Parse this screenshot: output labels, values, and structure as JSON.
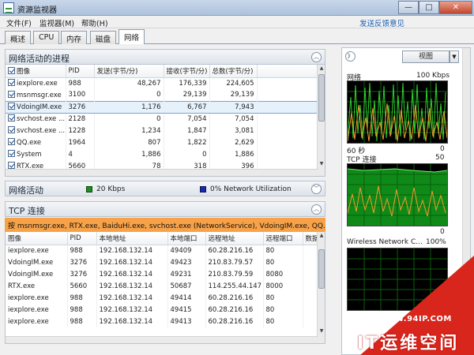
{
  "window": {
    "title": "资源监视器",
    "feedback_link": "发送反馈意见",
    "minimize": "—",
    "maximize": "□",
    "close": "✕"
  },
  "menu": [
    {
      "label": "文件(F)"
    },
    {
      "label": "监视器(M)"
    },
    {
      "label": "帮助(H)"
    }
  ],
  "tabs": [
    {
      "label": "概述"
    },
    {
      "label": "CPU"
    },
    {
      "label": "内存"
    },
    {
      "label": "磁盘"
    },
    {
      "label": "网络"
    }
  ],
  "processes": {
    "title": "网络活动的进程",
    "columns": [
      "图像",
      "PID",
      "发送(字节/分)",
      "接收(字节/分)",
      "总数(字节/分)"
    ],
    "rows": [
      {
        "image": "iexplore.exe",
        "pid": "988",
        "sent": "48,267",
        "recv": "176,339",
        "total": "224,605",
        "checked": true
      },
      {
        "image": "msnmsgr.exe",
        "pid": "3100",
        "sent": "0",
        "recv": "29,139",
        "total": "29,139",
        "checked": true
      },
      {
        "image": "VdoingIM.exe",
        "pid": "3276",
        "sent": "1,176",
        "recv": "6,767",
        "total": "7,943",
        "checked": true,
        "selected": true
      },
      {
        "image": "svchost.exe ...",
        "pid": "2128",
        "sent": "0",
        "recv": "7,054",
        "total": "7,054",
        "checked": true
      },
      {
        "image": "svchost.exe ...",
        "pid": "1228",
        "sent": "1,234",
        "recv": "1,847",
        "total": "3,081",
        "checked": true
      },
      {
        "image": "QQ.exe",
        "pid": "1964",
        "sent": "807",
        "recv": "1,822",
        "total": "2,629",
        "checked": true
      },
      {
        "image": "System",
        "pid": "4",
        "sent": "1,886",
        "recv": "0",
        "total": "1,886",
        "checked": true
      },
      {
        "image": "RTX.exe",
        "pid": "5660",
        "sent": "78",
        "recv": "318",
        "total": "396",
        "checked": true
      }
    ]
  },
  "network_activity": {
    "title": "网络活动",
    "kbps": "20 Kbps",
    "utilization": "0% Network Utilization",
    "color_green": "#1e8c1e",
    "color_blue": "#1b2aa8"
  },
  "tcp": {
    "title": "TCP 连接",
    "filter": "按 msnmsgr.exe, RTX.exe, BaiduHi.exe, svchost.exe (NetworkService), VdoingIM.exe, QQ.e...",
    "columns": [
      "图像",
      "PID",
      "本地地址",
      "本地端口",
      "远程地址",
      "远程端口",
      "数据"
    ],
    "rows": [
      {
        "image": "iexplore.exe",
        "pid": "988",
        "local": "192.168.132.14",
        "lport": "49409",
        "remote": "60.28.216.16",
        "rport": "80"
      },
      {
        "image": "VdoingIM.exe",
        "pid": "3276",
        "local": "192.168.132.14",
        "lport": "49423",
        "remote": "210.83.79.57",
        "rport": "80"
      },
      {
        "image": "VdoingIM.exe",
        "pid": "3276",
        "local": "192.168.132.14",
        "lport": "49231",
        "remote": "210.83.79.59",
        "rport": "8080"
      },
      {
        "image": "RTX.exe",
        "pid": "5660",
        "local": "192.168.132.14",
        "lport": "50687",
        "remote": "114.255.44.147",
        "rport": "8000"
      },
      {
        "image": "iexplore.exe",
        "pid": "988",
        "local": "192.168.132.14",
        "lport": "49414",
        "remote": "60.28.216.16",
        "rport": "80"
      },
      {
        "image": "iexplore.exe",
        "pid": "988",
        "local": "192.168.132.14",
        "lport": "49415",
        "remote": "60.28.216.16",
        "rport": "80"
      },
      {
        "image": "iexplore.exe",
        "pid": "988",
        "local": "192.168.132.14",
        "lport": "49413",
        "remote": "60.28.216.16",
        "rport": "80"
      }
    ]
  },
  "right_panel": {
    "view_label": "视图",
    "expand": "》",
    "network_graph": {
      "label": "网络",
      "max": "100 Kbps",
      "xlabel": "60 秒",
      "zero": "0"
    },
    "tcp_graph": {
      "label": "TCP 连接",
      "max": "50",
      "zero": "0"
    },
    "wireless_graph": {
      "label": "Wireless Network C...",
      "max": "100%"
    }
  },
  "watermark": {
    "url": "WWW.94IP.COM",
    "text": "IT运维空间"
  }
}
